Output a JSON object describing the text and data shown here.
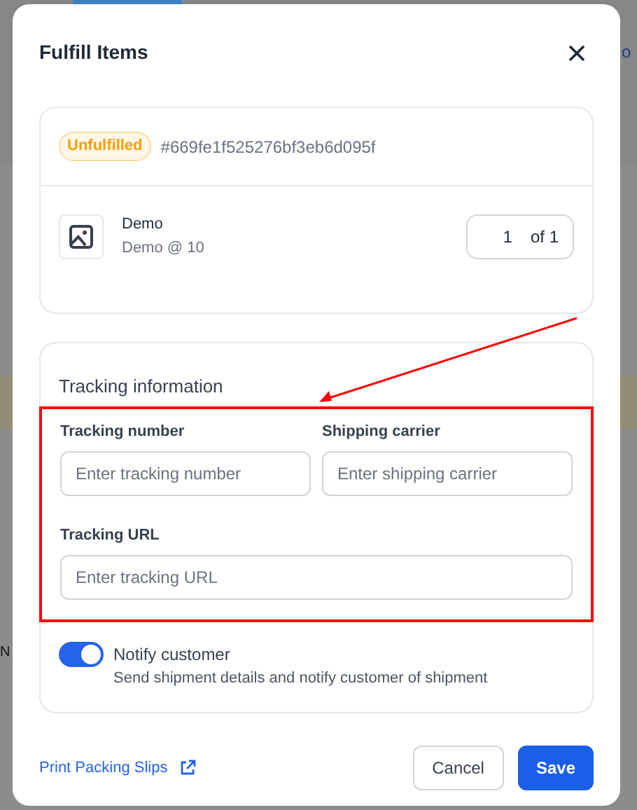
{
  "background": {
    "texts": [
      "o",
      "N"
    ]
  },
  "dialog": {
    "title": "Fulfill Items"
  },
  "order": {
    "status": "Unfulfilled",
    "id": "#669fe1f525276bf3eb6d095f"
  },
  "item": {
    "name": "Demo",
    "variant": "Demo @ 10",
    "quantity": "1",
    "of": "of 1"
  },
  "tracking": {
    "heading": "Tracking information",
    "highlighted": true,
    "fields": [
      {
        "label": "Tracking number",
        "placeholder": "Enter tracking number"
      },
      {
        "label": "Shipping carrier",
        "placeholder": "Enter shipping carrier"
      },
      {
        "label": "Tracking URL",
        "placeholder": "Enter tracking URL"
      }
    ]
  },
  "notify": {
    "on": true,
    "label": "Notify customer",
    "description": "Send shipment details and notify customer of shipment"
  },
  "footer": {
    "link": "Print Packing Slips",
    "buttons": [
      {
        "label": "Cancel",
        "kind": "secondary"
      },
      {
        "label": "Save",
        "kind": "primary"
      }
    ]
  }
}
